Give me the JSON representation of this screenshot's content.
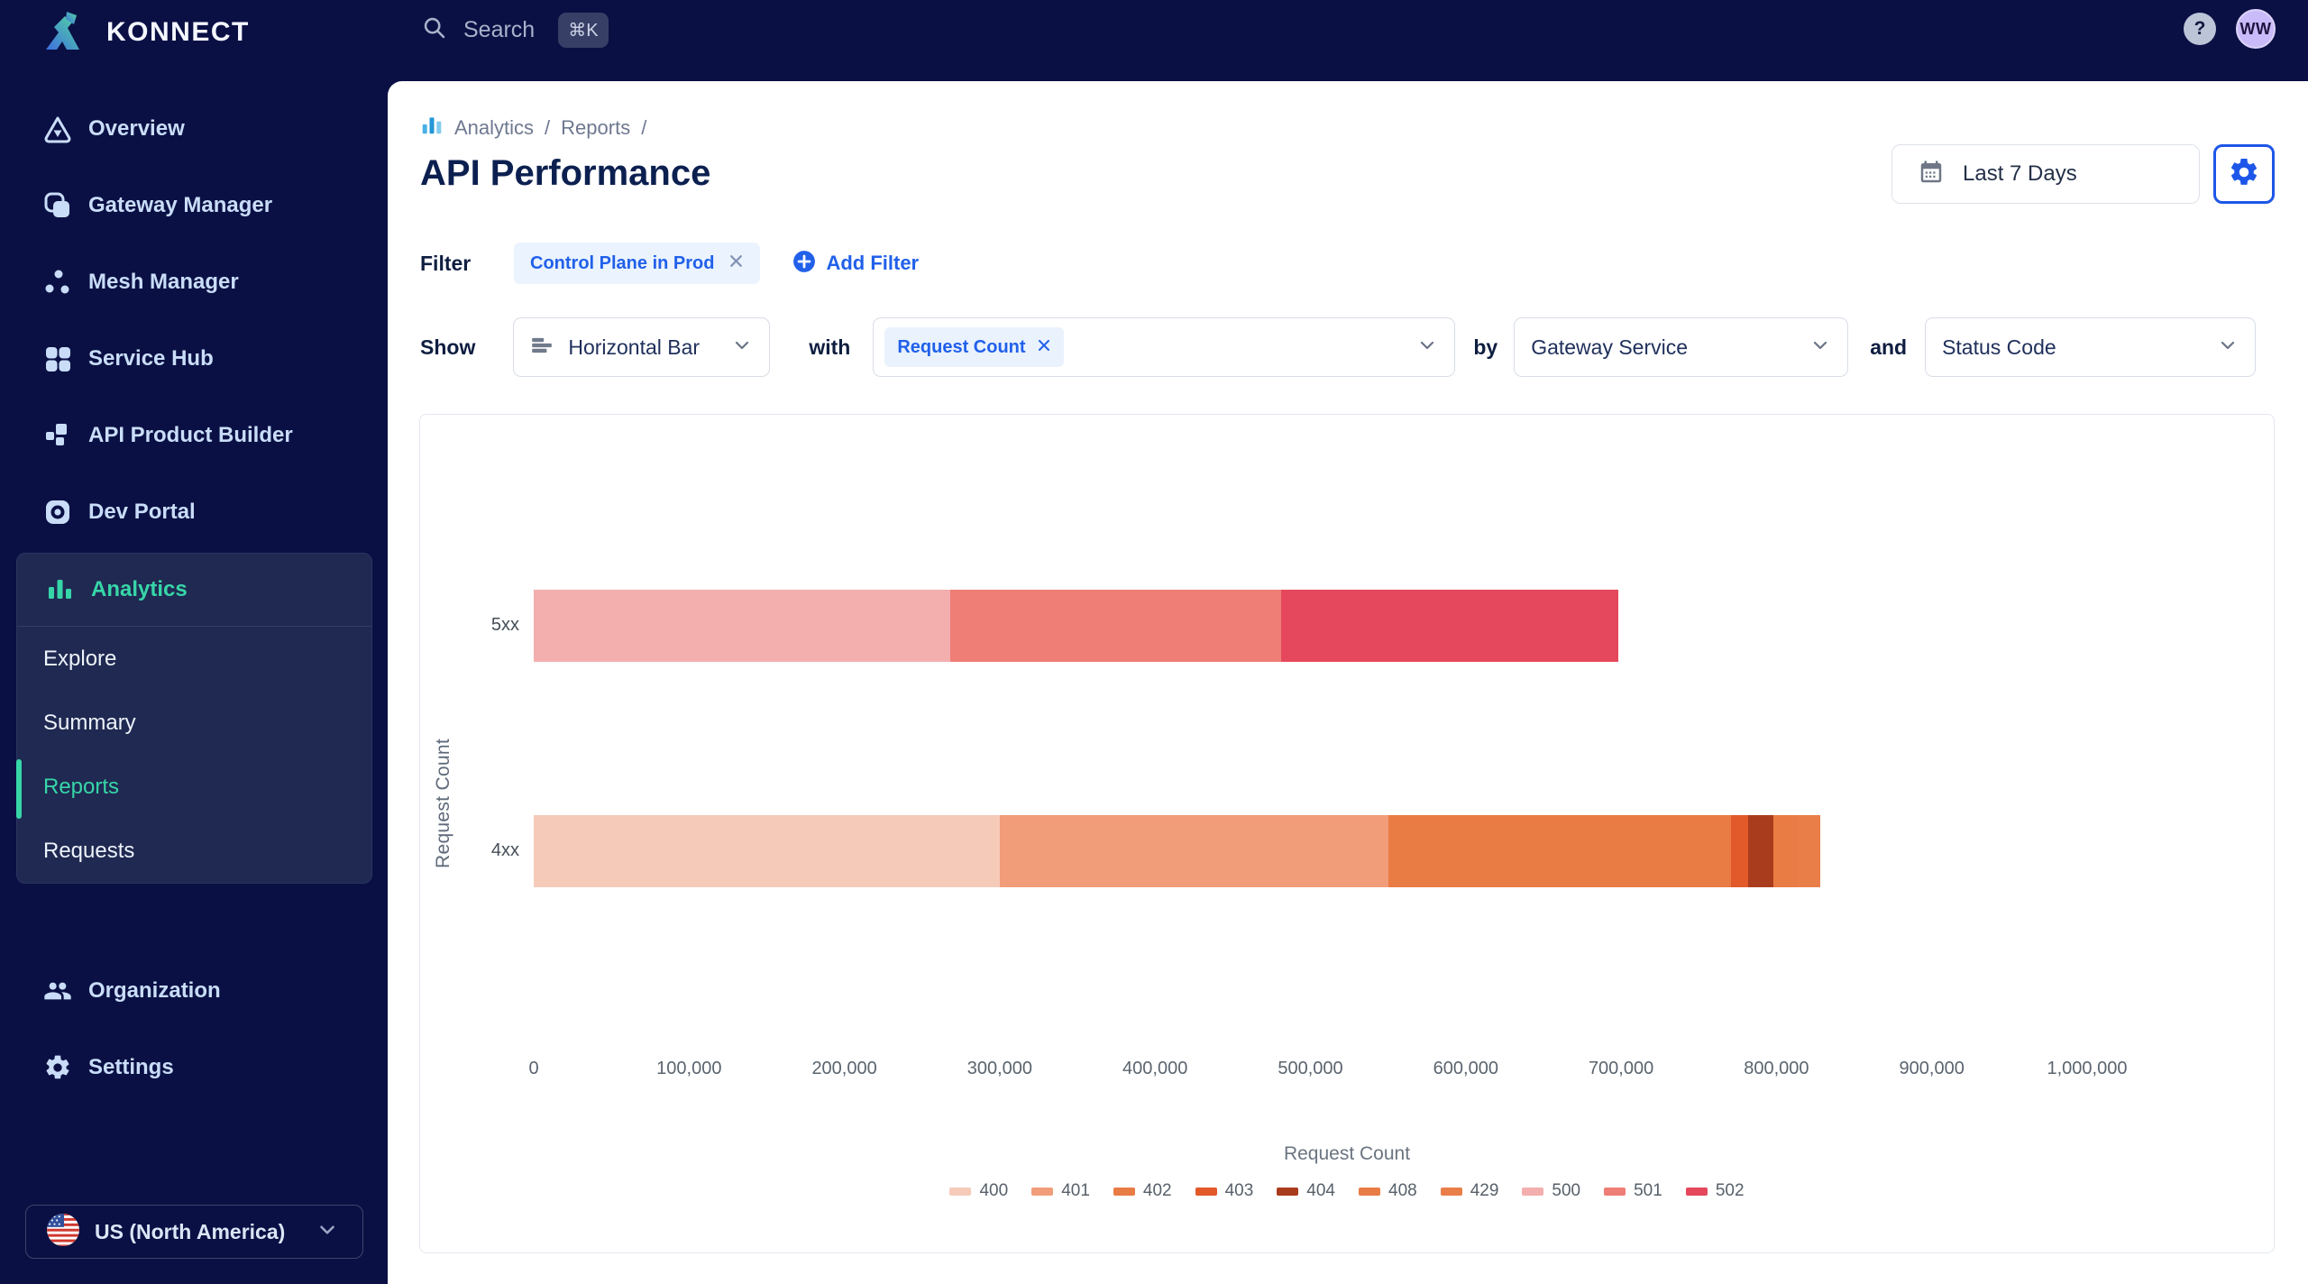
{
  "topbar": {
    "logo_text": "KONNECT",
    "search_label": "Search",
    "search_shortcut": "⌘K",
    "help_label": "?",
    "avatar_initials": "WW"
  },
  "sidebar": {
    "items": [
      {
        "label": "Overview"
      },
      {
        "label": "Gateway Manager"
      },
      {
        "label": "Mesh Manager"
      },
      {
        "label": "Service Hub"
      },
      {
        "label": "API Product Builder"
      },
      {
        "label": "Dev Portal"
      }
    ],
    "analytics": {
      "label": "Analytics",
      "items": [
        {
          "label": "Explore"
        },
        {
          "label": "Summary"
        },
        {
          "label": "Reports",
          "active": true
        },
        {
          "label": "Requests"
        }
      ]
    },
    "footer_items": [
      {
        "label": "Organization"
      },
      {
        "label": "Settings"
      }
    ],
    "region": {
      "label": "US (North America)"
    }
  },
  "header": {
    "breadcrumb": {
      "root": "Analytics",
      "separator1": "/",
      "section": "Reports",
      "separator2": "/"
    },
    "title": "API Performance",
    "date_range_label": "Last 7 Days"
  },
  "filters": {
    "label": "Filter",
    "chip": "Control Plane in Prod",
    "add_label": "Add Filter"
  },
  "controls": {
    "show_label": "Show",
    "chart_type": "Horizontal Bar",
    "with_label": "with",
    "metric": "Request Count",
    "by_label": "by",
    "group_by": "Gateway Service",
    "and_label": "and",
    "secondary_group_by": "Status Code"
  },
  "chart_data": {
    "type": "bar",
    "orientation": "horizontal",
    "stacked": true,
    "categories": [
      "5xx",
      "4xx"
    ],
    "series": [
      {
        "name": "400",
        "color": "#f6cab9",
        "values": [
          0,
          300000
        ]
      },
      {
        "name": "401",
        "color": "#f19d79",
        "values": [
          0,
          250000
        ]
      },
      {
        "name": "402",
        "color": "#e97b44",
        "values": [
          0,
          221000
        ]
      },
      {
        "name": "403",
        "color": "#e2592a",
        "values": [
          0,
          11000
        ]
      },
      {
        "name": "404",
        "color": "#a93c1c",
        "values": [
          0,
          16000
        ]
      },
      {
        "name": "408",
        "color": "#e97b44",
        "values": [
          0,
          15000
        ]
      },
      {
        "name": "429",
        "color": "#ea7e48",
        "values": [
          0,
          15000
        ]
      },
      {
        "name": "500",
        "color": "#f3aeae",
        "values": [
          268000,
          0
        ]
      },
      {
        "name": "501",
        "color": "#ee7e76",
        "values": [
          213000,
          0
        ]
      },
      {
        "name": "502",
        "color": "#e5485c",
        "values": [
          217000,
          0
        ]
      }
    ],
    "xlabel": "Request Count",
    "ylabel": "Request Count",
    "xlim": [
      0,
      1000000
    ],
    "xticks": [
      0,
      100000,
      200000,
      300000,
      400000,
      500000,
      600000,
      700000,
      800000,
      900000,
      1000000
    ],
    "grid": false,
    "legend_position": "bottom"
  }
}
